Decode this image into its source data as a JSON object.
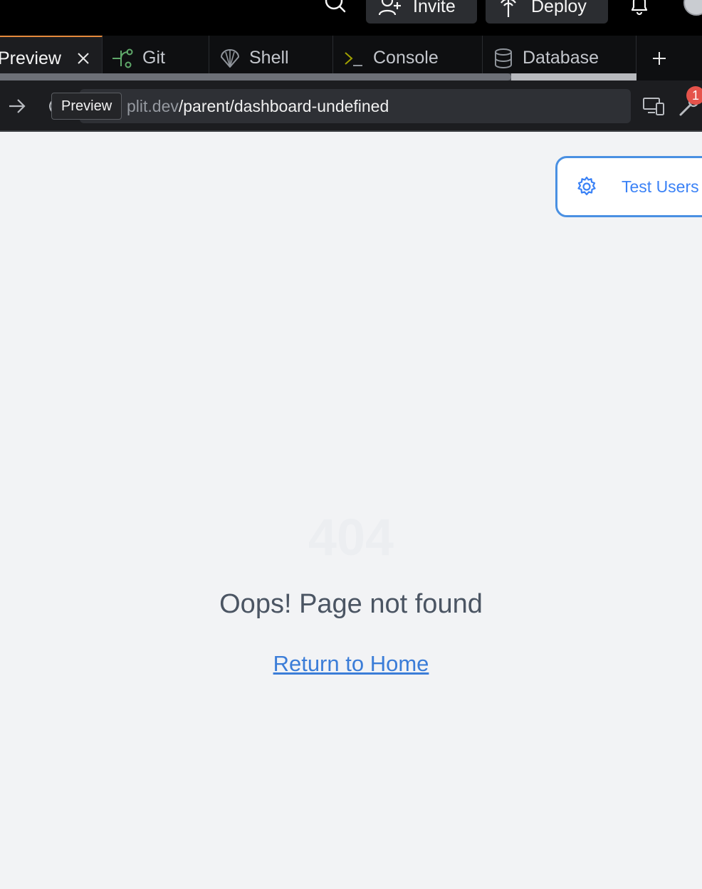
{
  "topbar": {
    "invite_label": "Invite",
    "deploy_label": "Deploy"
  },
  "tabs": [
    {
      "label": "Preview",
      "icon": "close-icon",
      "active": true
    },
    {
      "label": "Git",
      "icon": "git-icon"
    },
    {
      "label": "Shell",
      "icon": "shell-icon"
    },
    {
      "label": "Console",
      "icon": "console-icon"
    },
    {
      "label": "Database",
      "icon": "database-icon"
    }
  ],
  "urlbar": {
    "url_host": "plit.dev",
    "url_path": "/parent/dashboard-undefined",
    "tooltip": "Preview",
    "badge_count": "1"
  },
  "page": {
    "test_users_label": "Test Users",
    "error_code": "404",
    "message": "Oops! Page not found",
    "home_link": "Return to Home"
  },
  "colors": {
    "accent": "#3b82f6",
    "active_tab_border": "#e58a3c",
    "badge": "#e5534b",
    "page_bg": "#f2f3f5"
  }
}
